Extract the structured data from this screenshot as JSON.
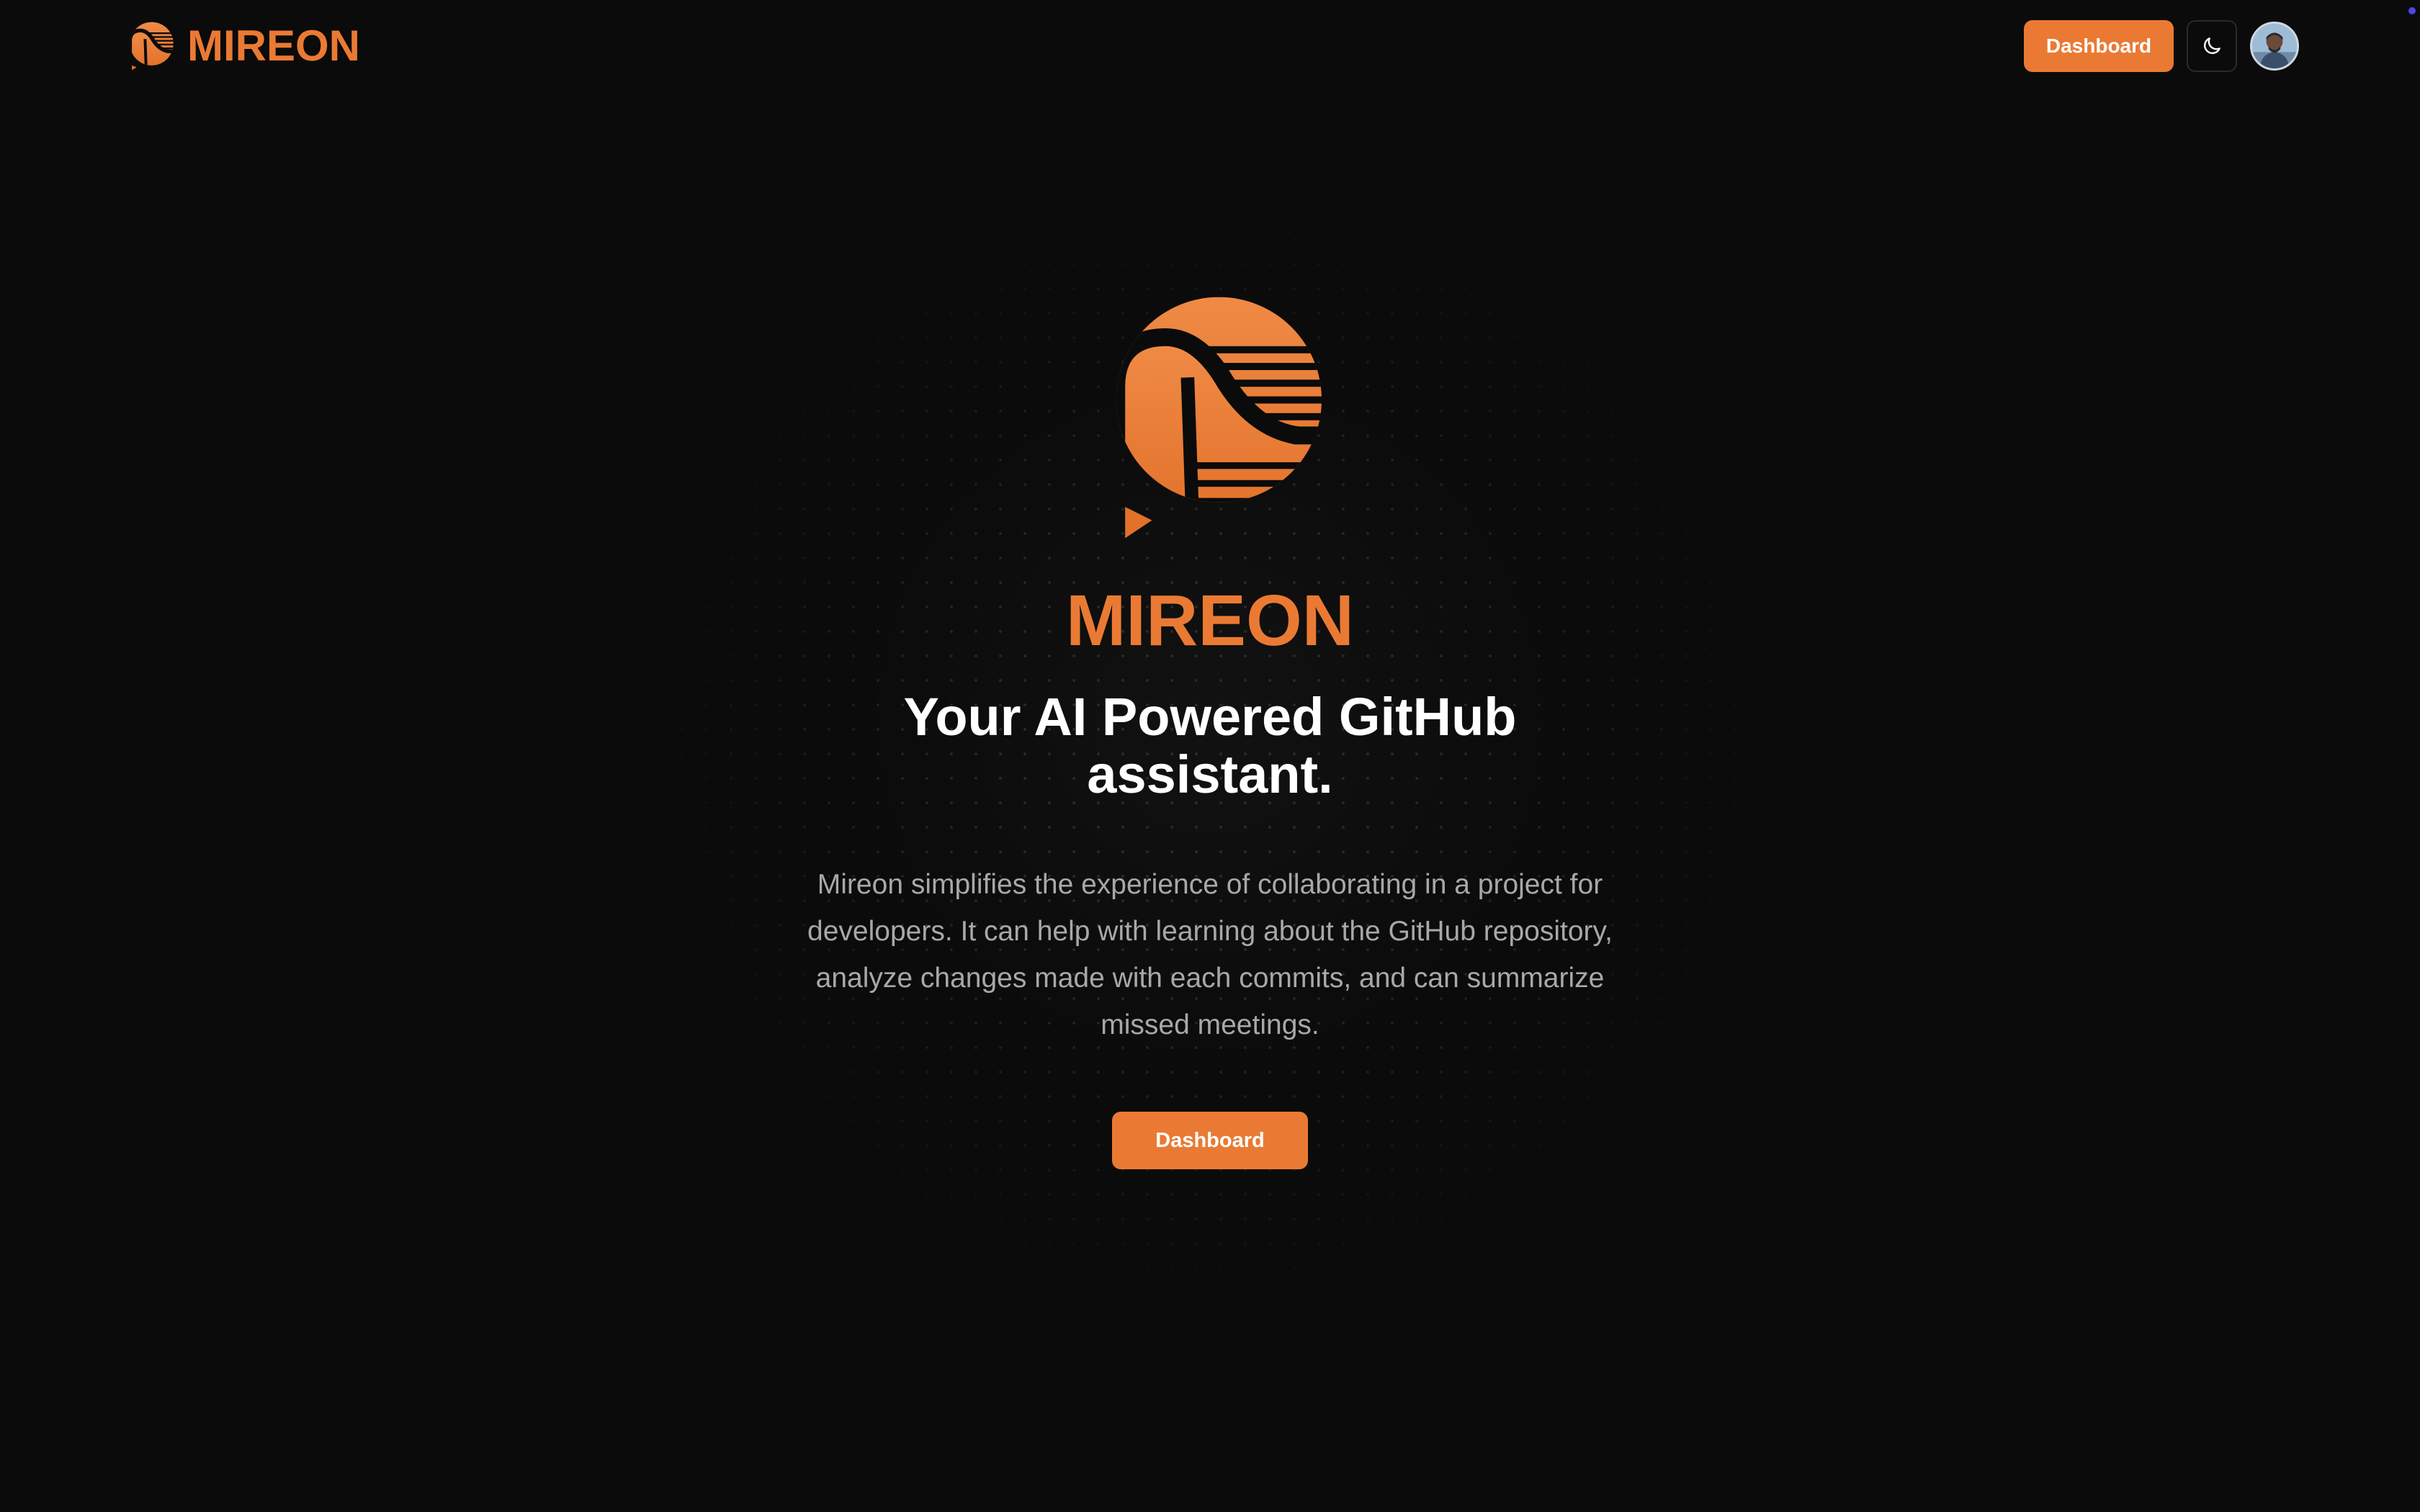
{
  "header": {
    "brand_name": "MIREON",
    "brand_logo_icon": "mireon-logo-icon",
    "dashboard_label": "Dashboard",
    "theme_toggle_icon": "moon-icon",
    "avatar_icon": "user-avatar"
  },
  "hero": {
    "logo_icon": "mireon-logo-icon",
    "brand_name": "MIREON",
    "tagline": "Your AI Powered GitHub assistant.",
    "description": "Mireon simplifies the experience of collaborating in a project for developers. It can help with learning about the GitHub repository, analyze changes made with each commits, and can summarize missed meetings.",
    "cta_label": "Dashboard"
  },
  "colors": {
    "accent": "#ea7a33",
    "background": "#0b0b0b",
    "heading": "#ffffff",
    "body_text": "#a8a8a8"
  }
}
